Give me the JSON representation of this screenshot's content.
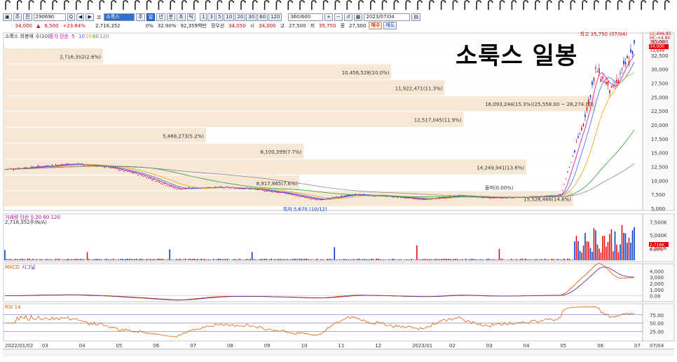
{
  "toolbar": {
    "code": "290690",
    "name": "소룩스",
    "period_buttons": [
      "주",
      "일",
      "년",
      "분",
      "초",
      "틱"
    ],
    "selected_period": "일",
    "interval_buttons": [
      "1",
      "3",
      "5",
      "10",
      "20",
      "30",
      "60",
      "120"
    ],
    "count": "360/600",
    "date": "2023/07/04"
  },
  "quote": {
    "price": "34,000",
    "change": "6,500",
    "change_pct": "+23.64%",
    "volume": "2,716,352",
    "turnover_label": "0%",
    "turnover": "32.90%",
    "amount": "92,359백만",
    "prev_label": "정우선",
    "open_val": "34,050",
    "high_val": "34,000",
    "low_val": "27,500",
    "close_val": "35,750",
    "last_val": "27,500",
    "buy_label": "매수",
    "sell_label": "매도"
  },
  "chart_title": "소룩스  일봉",
  "price_panel": {
    "legend": "소룩스 회봉매 수(10)",
    "ma_legend_prefix": "종가 단순",
    "ma_periods": [
      "5",
      "10",
      "20",
      "60",
      "120"
    ],
    "ma_colors": [
      "#e0009a",
      "#3366ff",
      "#e6a800",
      "#2ca02c",
      "#888888"
    ],
    "high_label": "최고 35,750 (07/04)",
    "low_label": "최저 5,670 (10/12)",
    "low_mark_label": "저",
    "high_mark_label": "고",
    "crossover_label": "돌파(0.00%)",
    "right_tags": [
      "LC:496.85",
      "HC:+4.90",
      "35,000",
      "34,000",
      "33,649"
    ],
    "current_price_tag": "34,000"
  },
  "volume_panel": {
    "legend_prefix": "거래량",
    "legend_ma": "단순 5  20  60  120",
    "legend_values": "2,716,352주(N/A)",
    "right_tag": "2,716K",
    "right_tag2": "0.00%"
  },
  "macd_panel": {
    "label": "MACD",
    "signal": "시그널"
  },
  "rsi_panel": {
    "label": "RSI 14"
  },
  "chart_data": [
    {
      "type": "line",
      "title": "소룩스  일봉",
      "panel": "price (candlestick, daily)",
      "ylim": [
        5000,
        35000
      ],
      "yticks": [
        "35,000",
        "32,500",
        "30,000",
        "27,500",
        "25,000",
        "22,500",
        "20,000",
        "17,500",
        "15,000",
        "12,500",
        "10,000",
        "7,500",
        "5,000"
      ],
      "x_labels": [
        "2022/01/02",
        "03",
        "04",
        "05",
        "06",
        "07",
        "08",
        "09",
        "10",
        "11",
        "12",
        "2023/01",
        "02",
        "03",
        "04",
        "05",
        "06",
        "07",
        "07/04"
      ],
      "series": [
        {
          "name": "종가",
          "x": [
            "2022-01",
            "2022-02",
            "2022-03",
            "2022-04",
            "2022-05",
            "2022-06",
            "2022-07",
            "2022-08",
            "2022-09",
            "2022-10",
            "2022-11",
            "2022-12",
            "2023-01",
            "2023-02",
            "2023-03",
            "2023-04",
            "2023-05",
            "2023-05-20",
            "2023-06",
            "2023-06-15",
            "2023-07-04"
          ],
          "values": [
            12000,
            12500,
            13000,
            12500,
            11000,
            8500,
            8800,
            8600,
            7800,
            6500,
            7500,
            7200,
            6600,
            7300,
            6900,
            7000,
            7400,
            20000,
            30000,
            26000,
            34000
          ]
        }
      ],
      "volume_profile": [
        {
          "label": "2,716,352(2.6%)",
          "rel_width": 0.168
        },
        {
          "label": "10,456,528(10.0%)",
          "rel_width": 0.655
        },
        {
          "label": "11,922,471(11.3%)",
          "rel_width": 0.745
        },
        {
          "label": "16,093,244(15.3%)(25,558.00 ~ 28,274.00)",
          "rel_width": 1.0
        },
        {
          "label": "12,517,045(11.9%)",
          "rel_width": 0.777
        },
        {
          "label": "5,468,273(5.2%)",
          "rel_width": 0.342
        },
        {
          "label": "8,100,399(7.7%)",
          "rel_width": 0.507
        },
        {
          "label": "14,249,941(13.6%)",
          "rel_width": 0.883
        },
        {
          "label": "8,917,865(7.6%)",
          "rel_width": 0.5
        },
        {
          "label": "15,528,466(14.8%)",
          "rel_width": 0.962
        }
      ]
    },
    {
      "type": "bar",
      "title": "거래량",
      "yticks": [
        "7,500K",
        "5,000K",
        "2,500K"
      ]
    },
    {
      "type": "line",
      "title": "MACD",
      "yticks": [
        "4,000",
        "3,000",
        "2,000",
        "1,000",
        "0.00"
      ],
      "series": [
        {
          "name": "MACD"
        },
        {
          "name": "시그널"
        }
      ]
    },
    {
      "type": "line",
      "title": "RSI 14",
      "ylim": [
        0,
        100
      ],
      "yticks": [
        "75.00",
        "50.00",
        "25.00"
      ],
      "series": [
        {
          "name": "RSI 14"
        }
      ]
    }
  ]
}
